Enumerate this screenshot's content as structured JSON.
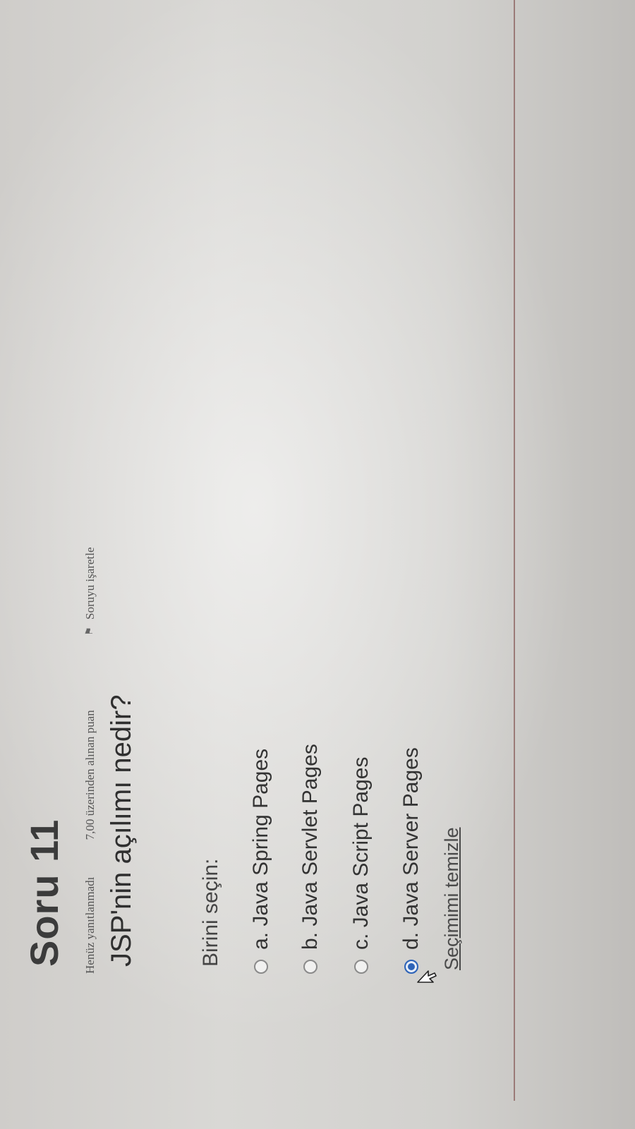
{
  "question": {
    "title": "Soru 11",
    "status": "Henüz yanıtlanmadı",
    "points": "7,00 üzerinden alınan puan",
    "flag_label": "Soruyu işaretle",
    "flag_icon": "flag-icon",
    "text": "JSP'nin açılımı nedir?",
    "prompt": "Birini seçin:"
  },
  "options": [
    {
      "label": "a. Java Spring Pages",
      "selected": false
    },
    {
      "label": "b. Java Servlet Pages",
      "selected": false
    },
    {
      "label": "c. Java Script Pages",
      "selected": false
    },
    {
      "label": "d. Java Server Pages",
      "selected": true
    }
  ],
  "actions": {
    "clear_label": "Seçimimi temizle"
  },
  "colors": {
    "selected_radio": "#2e64b8",
    "divider": "#9b7b78"
  }
}
